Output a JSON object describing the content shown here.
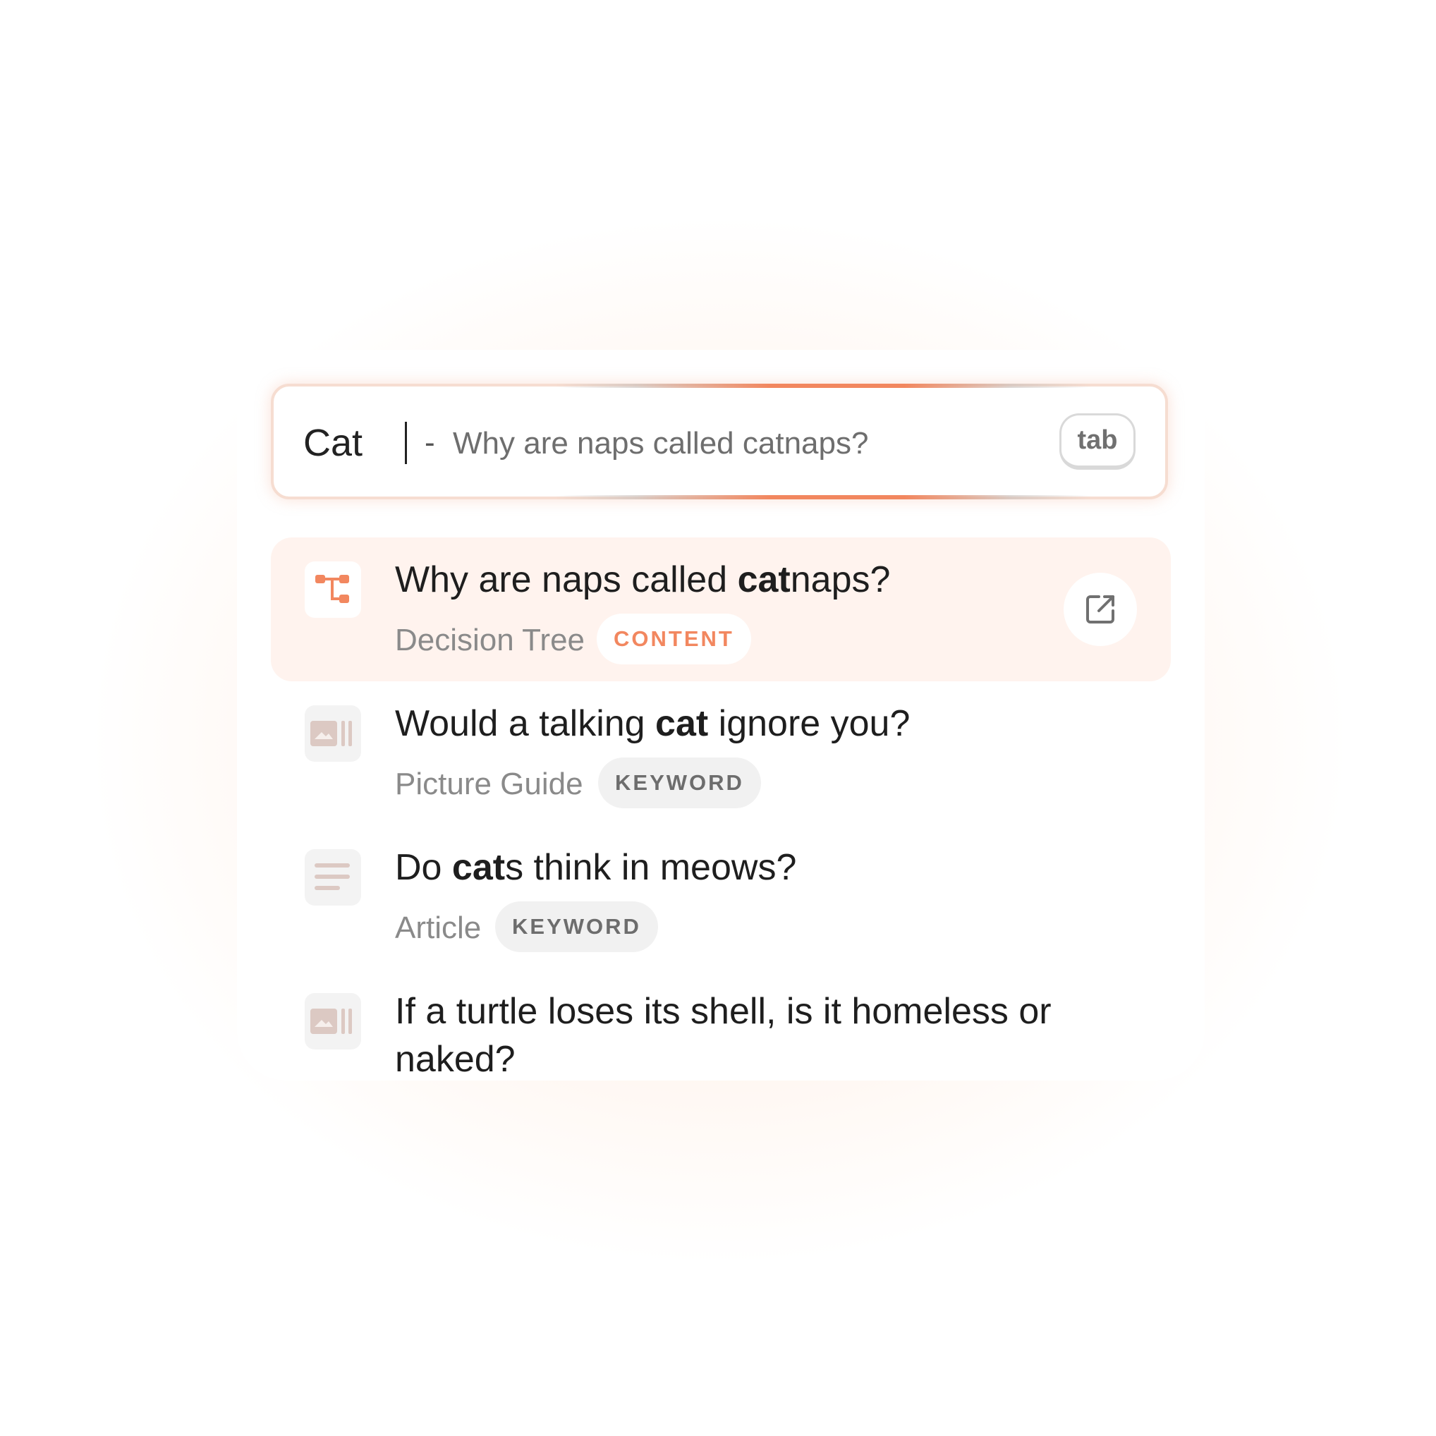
{
  "search": {
    "query": "Cat",
    "separator": "-",
    "suggestion": "Why are naps called catnaps?",
    "tab_key_label": "tab"
  },
  "results": [
    {
      "title_pre": "Why are naps called ",
      "title_bold": "cat",
      "title_post": "naps?",
      "type": "Decision Tree",
      "badge": "CONTENT",
      "icon": "decision-tree-icon",
      "active": true
    },
    {
      "title_pre": "Would a talking ",
      "title_bold": "cat",
      "title_post": " ignore you?",
      "type": "Picture Guide",
      "badge": "KEYWORD",
      "icon": "picture-guide-icon",
      "active": false
    },
    {
      "title_pre": "Do ",
      "title_bold": "cat",
      "title_post": "s think in meows?",
      "type": "Article",
      "badge": "KEYWORD",
      "icon": "article-icon",
      "active": false
    },
    {
      "title_pre": "If a turtle loses its shell, is it homeless or naked?",
      "title_bold": "",
      "title_post": "",
      "type": "",
      "badge": "",
      "icon": "picture-guide-icon",
      "active": false
    }
  ],
  "colors": {
    "accent": "#f2875f",
    "active_row": "#fff3ee",
    "icon_muted": "#dcc9c3",
    "text_primary": "#1e1e1e",
    "text_secondary": "#8a8a8a"
  }
}
